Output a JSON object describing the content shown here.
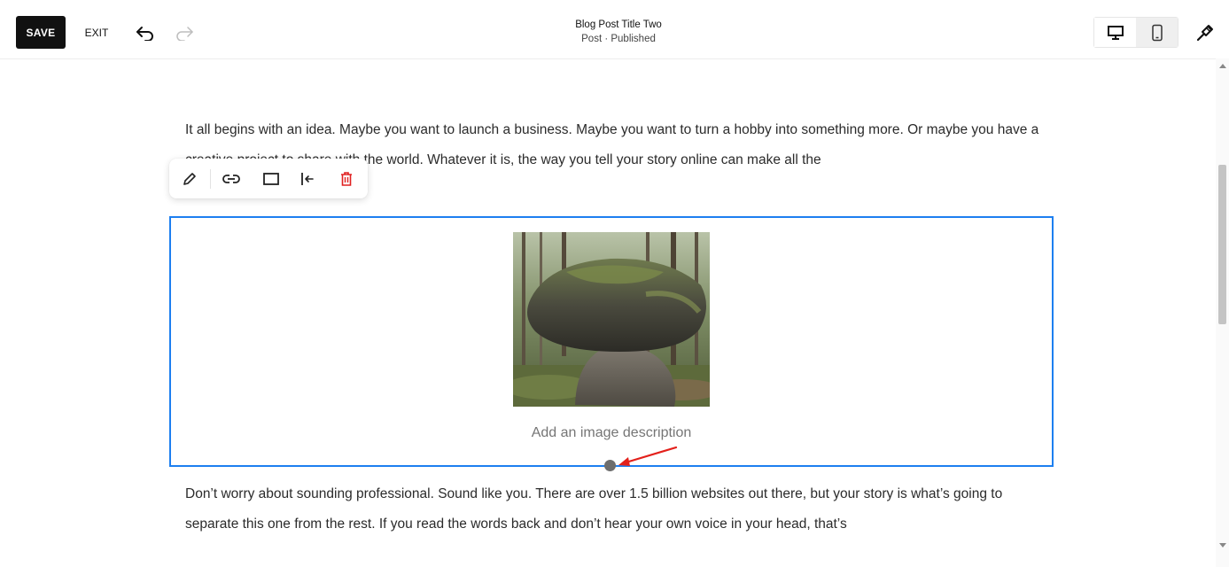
{
  "toolbar": {
    "save_label": "SAVE",
    "exit_label": "EXIT",
    "undo_icon": "undo-icon",
    "redo_icon": "redo-icon"
  },
  "document": {
    "title": "Blog Post Title Two",
    "status": "Post · Published"
  },
  "device_toggle": {
    "options": [
      "desktop-icon",
      "mobile-icon"
    ],
    "selected": "desktop"
  },
  "content": {
    "paragraph_1": "It all begins with an idea. Maybe you want to launch a business. Maybe you want to turn a hobby into something more. Or maybe you have a creative project to share with the world. Whatever it is, the way you tell your story online can make all the",
    "paragraph_2": "Don’t worry about sounding professional. Sound like you. There are over 1.5 billion websites out there, but your story is what’s going to separate this one from the rest. If you read the words back and don’t hear your own voice in your head, that’s"
  },
  "block_toolbar": {
    "items": [
      "pencil-icon",
      "link-icon",
      "square-icon",
      "align-left-icon",
      "trash-icon"
    ]
  },
  "image_block": {
    "caption_placeholder": "Add an image description"
  },
  "colors": {
    "accent": "#1d7ff0",
    "delete": "#e02020",
    "annotation": "#e3201b",
    "primary_button": "#111111"
  }
}
